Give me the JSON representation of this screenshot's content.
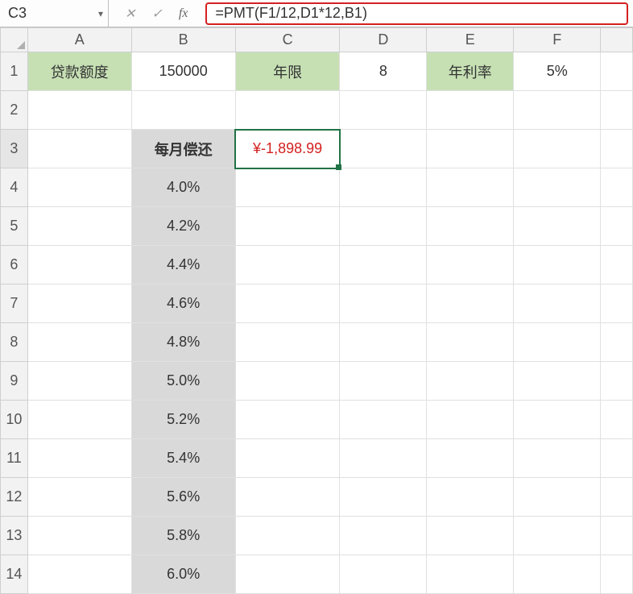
{
  "name_box": "C3",
  "formula": "=PMT(F1/12,D1*12,B1)",
  "columns": [
    "A",
    "B",
    "C",
    "D",
    "E",
    "F"
  ],
  "row1": {
    "A": "贷款额度",
    "B": "150000",
    "C": "年限",
    "D": "8",
    "E": "年利率",
    "F": "5%"
  },
  "row3": {
    "B": "每月偿还",
    "C": "¥-1,898.99"
  },
  "rates": [
    "4.0%",
    "4.2%",
    "4.4%",
    "4.6%",
    "4.8%",
    "5.0%",
    "5.2%",
    "5.4%",
    "5.6%",
    "5.8%",
    "6.0%"
  ],
  "icons": {
    "cancel": "✕",
    "enter": "✓",
    "fx": "fx",
    "dropdown": "▾"
  }
}
